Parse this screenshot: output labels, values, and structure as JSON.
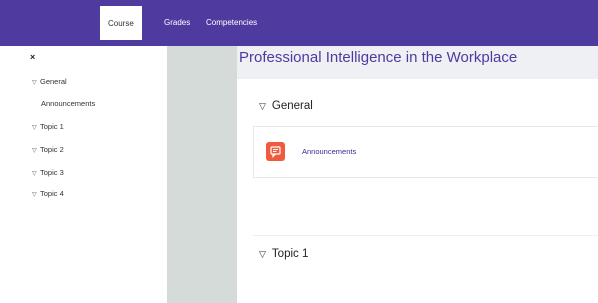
{
  "topnav": {
    "tabs": [
      {
        "label": "Course",
        "active": true
      },
      {
        "label": "Grades",
        "active": false
      },
      {
        "label": "Competencies",
        "active": false
      }
    ]
  },
  "sidebar": {
    "close_glyph": "×",
    "items": [
      {
        "label": "General",
        "expandable": true
      },
      {
        "label": "Announcements",
        "expandable": false
      },
      {
        "label": "Topic 1",
        "expandable": true
      },
      {
        "label": "Topic 2",
        "expandable": true
      },
      {
        "label": "Topic 3",
        "expandable": true
      },
      {
        "label": "Topic 4",
        "expandable": true
      }
    ]
  },
  "main": {
    "course_title": "Professional Intelligence in the Workplace",
    "sections": [
      {
        "title": "General",
        "activities": [
          {
            "label": "Announcements",
            "icon": "forum-icon"
          }
        ]
      },
      {
        "title": "Topic 1",
        "activities": []
      }
    ]
  },
  "colors": {
    "brand": "#4f3aa0",
    "activity_icon": "#f05a3e",
    "background": "#d5dbd9"
  }
}
